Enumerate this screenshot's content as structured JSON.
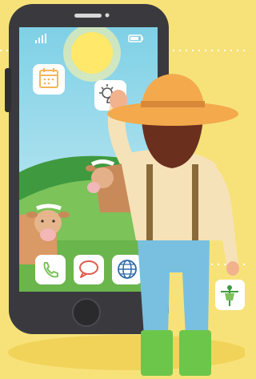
{
  "scene": {
    "background_color": "#f7e27a",
    "dotted_line_color": "#ffffff"
  },
  "phone": {
    "body_color": "#3a3a3e",
    "screen": {
      "sky_top": "#7fd0e6",
      "sky_bottom": "#c9ecf3",
      "sun_color": "#ffe86a",
      "hill_dark": "#3f9a3f",
      "hill_light": "#7cc35a",
      "ground": "#6bb54d"
    },
    "status_bar": {
      "signal_icon": "signal-bars-icon",
      "battery_icon": "battery-icon"
    },
    "apps": [
      {
        "name": "calendar-app",
        "icon": "calendar-icon"
      },
      {
        "name": "weather-app",
        "icon": "sun-cloud-icon"
      },
      {
        "name": "phone-app",
        "icon": "phone-handset-icon"
      },
      {
        "name": "messages-app",
        "icon": "speech-bubble-icon"
      },
      {
        "name": "browser-app",
        "icon": "globe-icon"
      }
    ]
  },
  "farmer": {
    "hat_color": "#f3a94c",
    "hat_band": "#d9883a",
    "hair_color": "#6b2f1e",
    "shirt_color": "#f6e2b8",
    "suspenders_color": "#8a6a3a",
    "pants_color": "#79c0e0",
    "boots_color": "#6cc64a",
    "skin_color": "#f2b28e"
  },
  "side_icon": {
    "icon": "scarecrow-icon"
  }
}
